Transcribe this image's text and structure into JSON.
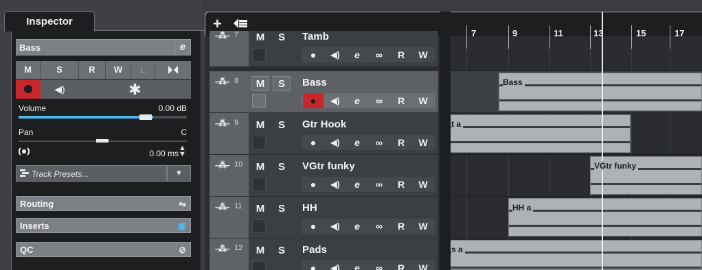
{
  "inspector": {
    "tab_label": "Inspector",
    "track_name": "Bass",
    "buttons_row1": [
      "M",
      "S",
      "R",
      "W",
      "L"
    ],
    "volume_label": "Volume",
    "volume_value": "0.00 dB",
    "volume_level": 0.8,
    "pan_label": "Pan",
    "pan_value": "C",
    "delay_value": "0.00 ms",
    "track_presets_placeholder": "Track Presets...",
    "sections": [
      "Routing",
      "Inserts",
      "QC"
    ]
  },
  "tracklist": {
    "tracks": [
      {
        "num": "7",
        "name": "Tamb",
        "m": "M",
        "s": "S",
        "r": "R",
        "w": "W"
      },
      {
        "num": "8",
        "name": "Bass",
        "m": "M",
        "s": "S",
        "r": "R",
        "w": "W"
      },
      {
        "num": "9",
        "name": "Gtr Hook",
        "m": "M",
        "s": "S",
        "r": "R",
        "w": "W"
      },
      {
        "num": "10",
        "name": "VGtr funky",
        "m": "M",
        "s": "S",
        "r": "R",
        "w": "W"
      },
      {
        "num": "11",
        "name": "HH",
        "m": "M",
        "s": "S",
        "r": "R",
        "w": "W"
      },
      {
        "num": "12",
        "name": "Pads",
        "m": "M",
        "s": "S",
        "r": "R",
        "w": "W"
      }
    ]
  },
  "ruler": {
    "bars": [
      "7",
      "9",
      "11",
      "13",
      "15",
      "17"
    ]
  },
  "events": [
    {
      "name": "Bass"
    },
    {
      "name": "t a"
    },
    {
      "name": "VGtr funky"
    },
    {
      "name": "HH a"
    },
    {
      "name": "s a"
    }
  ],
  "colors": {
    "accent": "#4fb6f0",
    "record": "#c8252c",
    "selected_track": "#5d6064"
  }
}
